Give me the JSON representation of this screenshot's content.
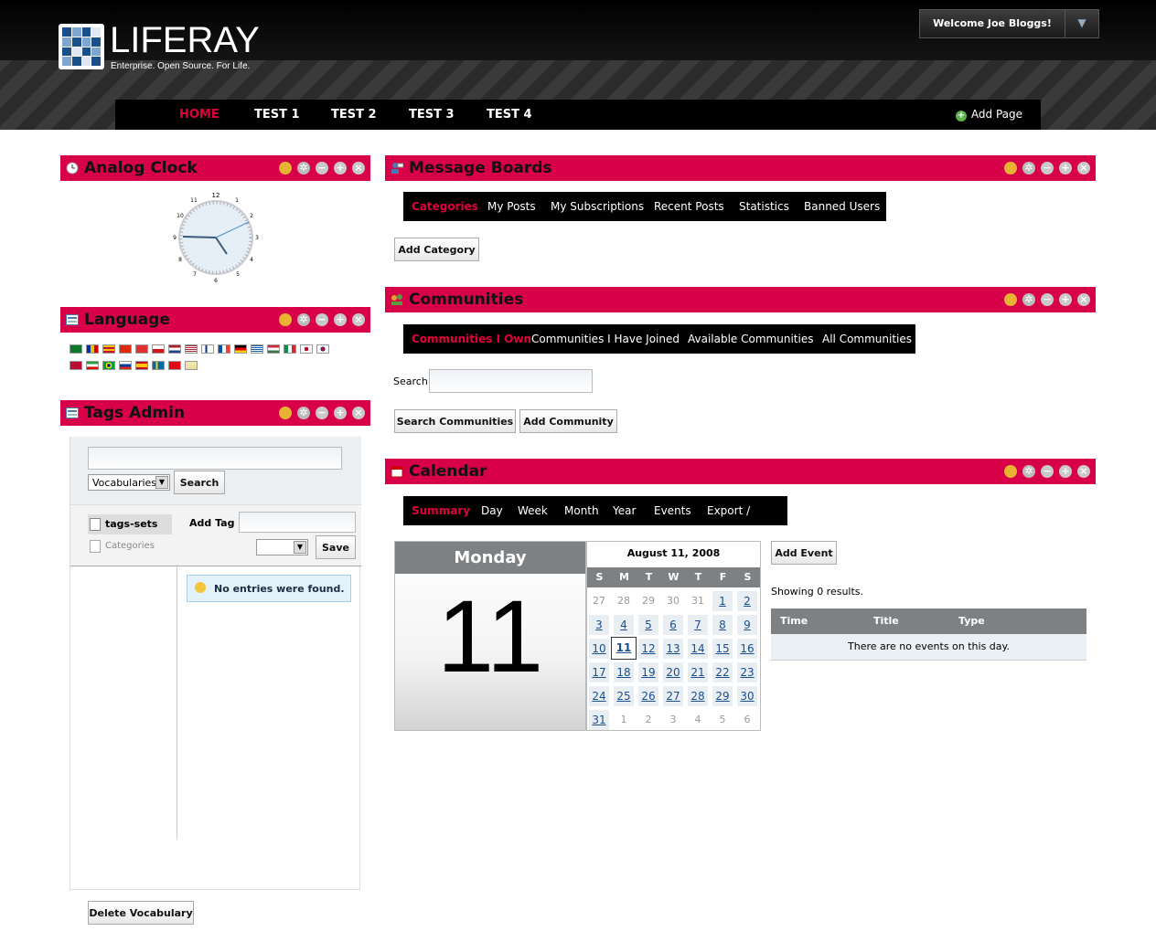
{
  "header": {
    "logo_text": "LIFERAY",
    "logo_tagline": "Enterprise. Open Source. For Life.",
    "welcome": "Welcome Joe Bloggs!",
    "nav": [
      "HOME",
      "TEST 1",
      "TEST 2",
      "TEST 3",
      "TEST 4"
    ],
    "add_page": "Add Page"
  },
  "analog_clock": {
    "title": "Analog Clock",
    "numbers": [
      "12",
      "1",
      "2",
      "3",
      "4",
      "5",
      "6",
      "7",
      "8",
      "9",
      "10",
      "11"
    ]
  },
  "language": {
    "title": "Language"
  },
  "tags_admin": {
    "title": "Tags Admin",
    "vocab_select": "Vocabularies",
    "search_button": "Search",
    "tags_sets": "tags-sets",
    "categories": "Categories",
    "add_tag_label": "Add Tag",
    "save_button": "Save",
    "no_entries": "No entries were found.",
    "delete_vocabulary": "Delete Vocabulary"
  },
  "message_boards": {
    "title": "Message Boards",
    "tabs": [
      "Categories",
      "My Posts",
      "My Subscriptions",
      "Recent Posts",
      "Statistics",
      "Banned Users"
    ],
    "add_category": "Add Category"
  },
  "communities": {
    "title": "Communities",
    "tabs": [
      "Communities I Own",
      "Communities I Have Joined",
      "Available Communities",
      "All Communities"
    ],
    "search_label": "Search",
    "search_button": "Search Communities",
    "add_button": "Add Community"
  },
  "calendar": {
    "title": "Calendar",
    "tabs": [
      "Summary",
      "Day",
      "Week",
      "Month",
      "Year",
      "Events",
      "Export / Import"
    ],
    "weekday": "Monday",
    "day_number": "11",
    "month_title": "August 11, 2008",
    "day_headers": [
      "S",
      "M",
      "T",
      "W",
      "T",
      "F",
      "S"
    ],
    "weeks": [
      [
        "27",
        "28",
        "29",
        "30",
        "31",
        "1",
        "2"
      ],
      [
        "3",
        "4",
        "5",
        "6",
        "7",
        "8",
        "9"
      ],
      [
        "10",
        "11",
        "12",
        "13",
        "14",
        "15",
        "16"
      ],
      [
        "17",
        "18",
        "19",
        "20",
        "21",
        "22",
        "23"
      ],
      [
        "24",
        "25",
        "26",
        "27",
        "28",
        "29",
        "30"
      ],
      [
        "31",
        "1",
        "2",
        "3",
        "4",
        "5",
        "6"
      ]
    ],
    "add_event": "Add Event",
    "showing": "Showing 0 results.",
    "columns": [
      "Time",
      "Title",
      "Type"
    ],
    "no_events": "There are no events on this day."
  },
  "colors": {
    "accent": "#d9004a",
    "nav_active": "#e0003a"
  }
}
